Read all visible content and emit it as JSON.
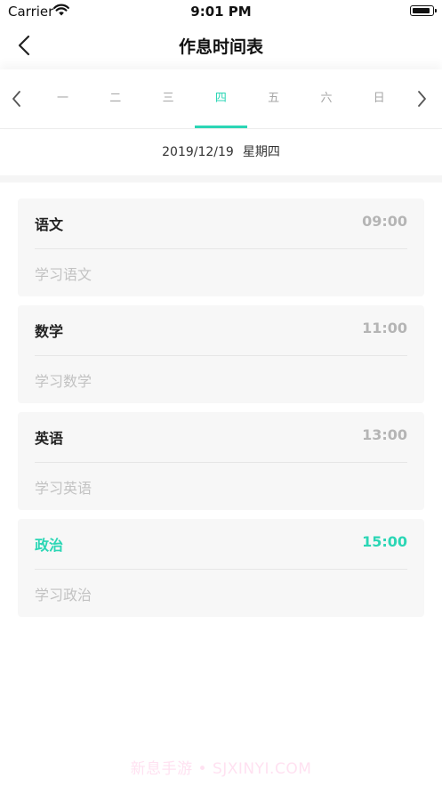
{
  "status_bar": {
    "carrier": "Carrier",
    "time": "9:01 PM"
  },
  "nav": {
    "title": "作息时间表"
  },
  "week": {
    "days": [
      "一",
      "二",
      "三",
      "四",
      "五",
      "六",
      "日"
    ],
    "selected_index": 3
  },
  "date": {
    "value": "2019/12/19",
    "weekday": "星期四"
  },
  "schedule": [
    {
      "subject": "语文",
      "time": "09:00",
      "desc": "学习语文",
      "highlight": false
    },
    {
      "subject": "数学",
      "time": "11:00",
      "desc": "学习数学",
      "highlight": false
    },
    {
      "subject": "英语",
      "time": "13:00",
      "desc": "学习英语",
      "highlight": false
    },
    {
      "subject": "政治",
      "time": "15:00",
      "desc": "学习政治",
      "highlight": true
    }
  ],
  "colors": {
    "accent": "#2bd6b5",
    "card_bg": "#f7f7f7",
    "muted_text": "#c2c2c2"
  },
  "watermark": "新息手游 • SJXINYI.COM"
}
